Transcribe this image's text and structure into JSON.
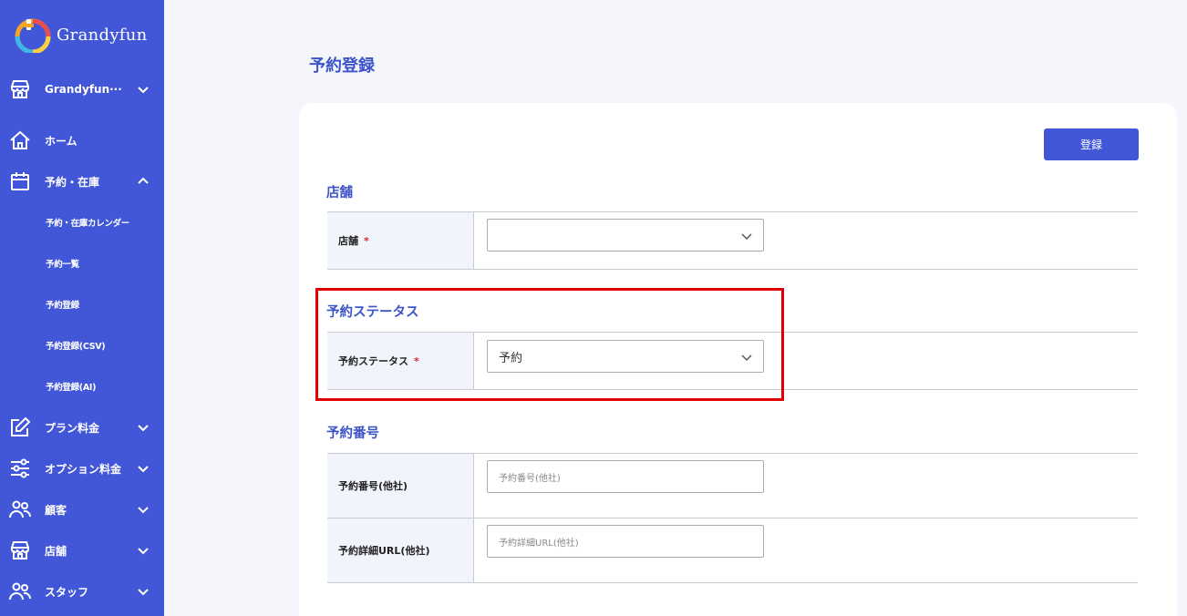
{
  "brand": {
    "name": "Grandyfun"
  },
  "sidebar": {
    "store_selector": "Grandyfun···",
    "items": [
      {
        "label": "ホーム",
        "icon": "home-icon"
      },
      {
        "label": "予約・在庫",
        "icon": "calendar-icon",
        "expanded": true
      },
      {
        "label": "プラン料金",
        "icon": "edit-icon"
      },
      {
        "label": "オプション料金",
        "icon": "sliders-icon"
      },
      {
        "label": "顧客",
        "icon": "users-icon"
      },
      {
        "label": "店舗",
        "icon": "store-icon"
      },
      {
        "label": "スタッフ",
        "icon": "users-icon"
      }
    ],
    "sub_items": [
      {
        "label": "予約・在庫カレンダー"
      },
      {
        "label": "予約一覧"
      },
      {
        "label": "予約登録"
      },
      {
        "label": "予約登録(CSV)"
      },
      {
        "label": "予約登録(AI)"
      }
    ]
  },
  "main": {
    "title": "予約登録",
    "register_button": "登録",
    "sections": [
      {
        "title": "店舗",
        "fields": [
          {
            "label": "店舗",
            "required": "*",
            "value": ""
          }
        ]
      },
      {
        "title": "予約ステータス",
        "fields": [
          {
            "label": "予約ステータス",
            "required": "*",
            "value": "予約"
          }
        ]
      },
      {
        "title": "予約番号",
        "fields": [
          {
            "label": "予約番号(他社)",
            "placeholder": "予約番号(他社)"
          },
          {
            "label": "予約詳細URL(他社)",
            "placeholder": "予約詳細URL(他社)"
          }
        ]
      }
    ]
  },
  "colors": {
    "sidebar": "#4257d8",
    "accent": "#3d54c9",
    "required": "#e0242e",
    "highlight": "#e00000"
  }
}
